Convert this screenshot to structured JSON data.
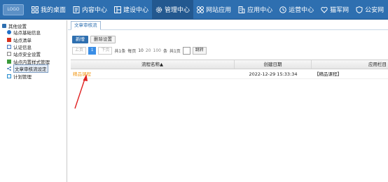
{
  "logo": {
    "text": "LOGO"
  },
  "nav": [
    {
      "label": "我的桌面",
      "icon": "grid-icon"
    },
    {
      "label": "内容中心",
      "icon": "document-icon"
    },
    {
      "label": "建设中心",
      "icon": "layout-icon"
    },
    {
      "label": "管理中心",
      "icon": "gear-icon"
    },
    {
      "label": "网站应用",
      "icon": "apps-icon"
    },
    {
      "label": "应用中心",
      "icon": "building-icon"
    },
    {
      "label": "运营中心",
      "icon": "clock-icon"
    },
    {
      "label": "猫军网",
      "icon": "heart-icon"
    },
    {
      "label": "公安网",
      "icon": "shield-icon"
    }
  ],
  "sidebar": {
    "root": "其他设置",
    "items": [
      {
        "label": "站点基础信息",
        "color": "#1f6fc7"
      },
      {
        "label": "站点清单",
        "color": "#d8321f"
      },
      {
        "label": "认证信息",
        "color": "#4f7fc1"
      },
      {
        "label": "站点安全设置",
        "color": "#8a8a8a"
      },
      {
        "label": "站点内置样式管理",
        "color": "#3a9a3a"
      },
      {
        "label": "文章审核流设定",
        "color": "#2e6fb0"
      },
      {
        "label": "计划管理",
        "color": "#2a8fd0"
      }
    ]
  },
  "main": {
    "tab": "文章审核流",
    "toolbar": {
      "add": "新增",
      "delete": "删除设置"
    },
    "pager": {
      "prev": "上页",
      "current": "1",
      "next": "下页",
      "total": "共1条",
      "per_page_label": "每页",
      "sizes": [
        "10",
        "20",
        "100"
      ],
      "per_page_unit": "条",
      "pages": "共1页",
      "jump": "跳转"
    },
    "table": {
      "headers": [
        "流程名称▲",
        "创建日期",
        "应用栏目"
      ],
      "rows": [
        {
          "name": "精品课程",
          "date": "2022-12-29 15:33:34",
          "column": "【精品课程】"
        }
      ]
    }
  }
}
